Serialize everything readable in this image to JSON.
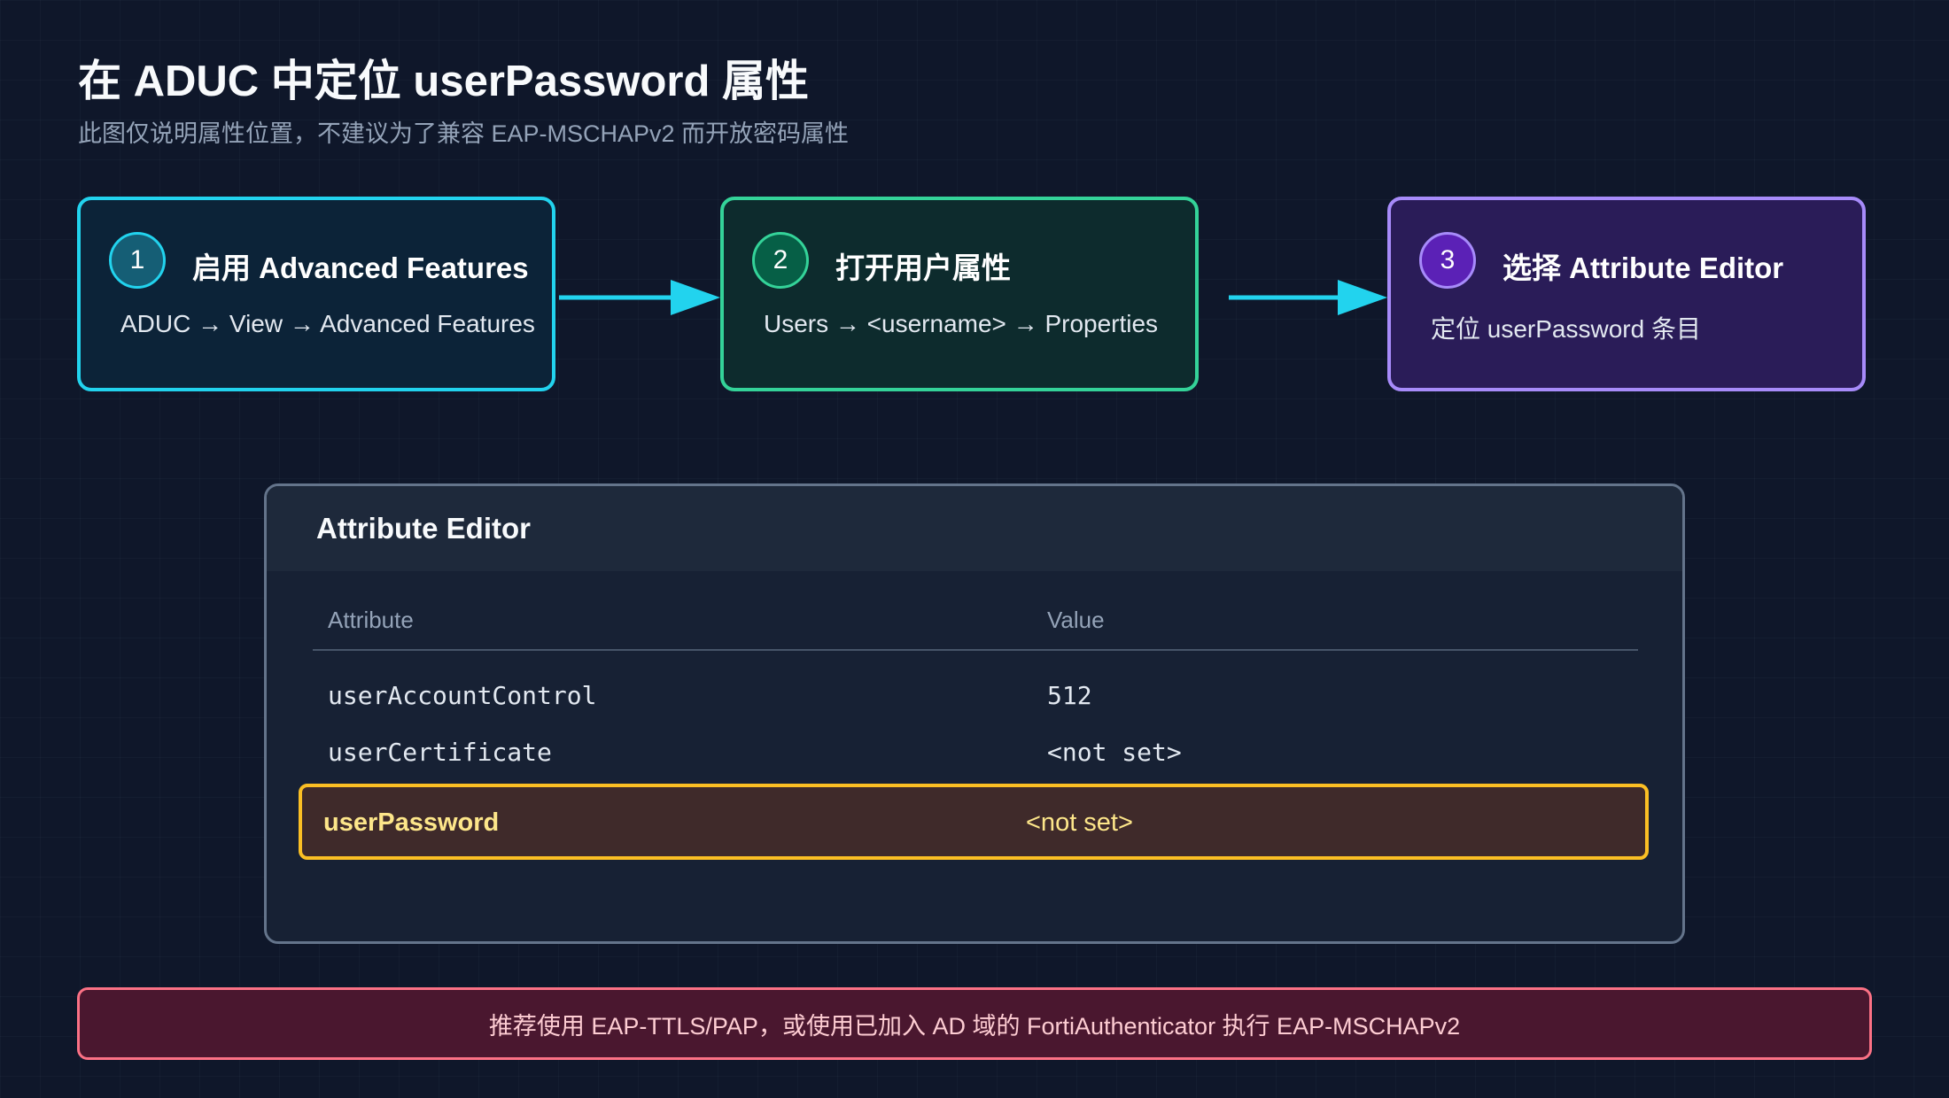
{
  "title": "在 ADUC 中定位 userPassword 属性",
  "subtitle": "此图仅说明属性位置，不建议为了兼容 EAP-MSCHAPv2 而开放密码属性",
  "steps": [
    {
      "number": "1",
      "title": "启用 Advanced Features",
      "description": "ADUC → View → Advanced Features",
      "color": "#22d3ee"
    },
    {
      "number": "2",
      "title": "打开用户属性",
      "description": "Users → <username> → Properties",
      "color": "#34d399"
    },
    {
      "number": "3",
      "title": "选择 Attribute Editor",
      "description": "定位 userPassword 条目",
      "color": "#a78bfa"
    }
  ],
  "editor": {
    "title": "Attribute Editor",
    "columns": [
      "Attribute",
      "Value"
    ],
    "rows": [
      {
        "attribute": "userAccountControl",
        "value": "512"
      },
      {
        "attribute": "userCertificate",
        "value": "<not set>"
      }
    ],
    "highlighted_row": {
      "attribute": "userPassword",
      "value": "<not set>",
      "color": "#fbbf24"
    }
  },
  "note": "推荐使用 EAP-TTLS/PAP，或使用已加入 AD 域的 FortiAuthenticator 执行 EAP-MSCHAPv2"
}
